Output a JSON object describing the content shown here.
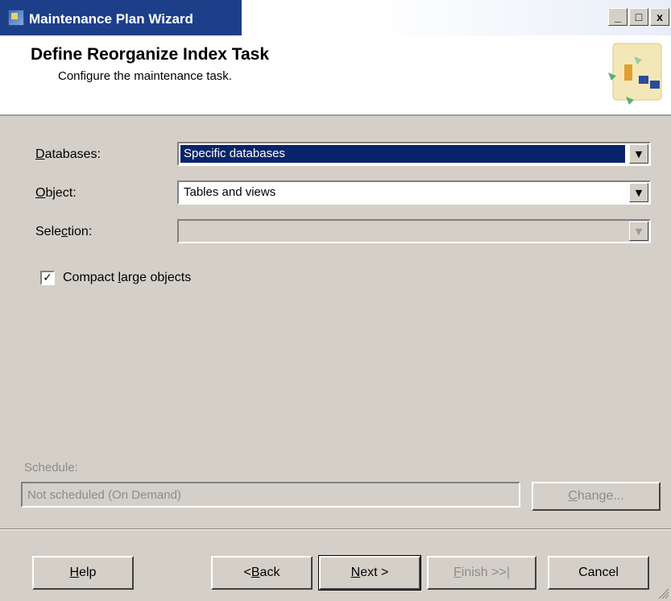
{
  "window": {
    "title": "Maintenance Plan Wizard",
    "minimize": "_",
    "maximize": "□",
    "close": "x"
  },
  "header": {
    "title": "Define Reorganize Index Task",
    "subtitle": "Configure the maintenance task."
  },
  "form": {
    "databases": {
      "label_acc": "D",
      "label_rest": "atabases:",
      "value": "Specific databases"
    },
    "object": {
      "label_acc": "O",
      "label_rest": "bject:",
      "value": "Tables and views"
    },
    "selection": {
      "label_pre": "Sele",
      "label_acc": "c",
      "label_rest": "tion:",
      "value": ""
    },
    "compact": {
      "checked": true,
      "mark": "✓",
      "label_pre": "Compact ",
      "label_acc": "l",
      "label_rest": "arge objects"
    }
  },
  "schedule": {
    "label": "Schedule:",
    "value": "Not scheduled (On Demand)",
    "change_acc": "C",
    "change_rest": "hange..."
  },
  "buttons": {
    "help_acc": "H",
    "help_rest": "elp",
    "back_pre": "< ",
    "back_acc": "B",
    "back_rest": "ack",
    "next_acc": "N",
    "next_rest": "ext >",
    "finish_acc": "F",
    "finish_rest": "inish >>|",
    "cancel": "Cancel"
  },
  "colors": {
    "titlebar": "#1d3f8a",
    "selection_highlight": "#0a246a",
    "dialog_face": "#d4d0c8"
  },
  "icons": {
    "app": "maintenance-plan-icon",
    "header_art": "wizard-graphic-icon",
    "dropdown": "chevron-down-icon",
    "resize": "resize-grip-icon"
  }
}
